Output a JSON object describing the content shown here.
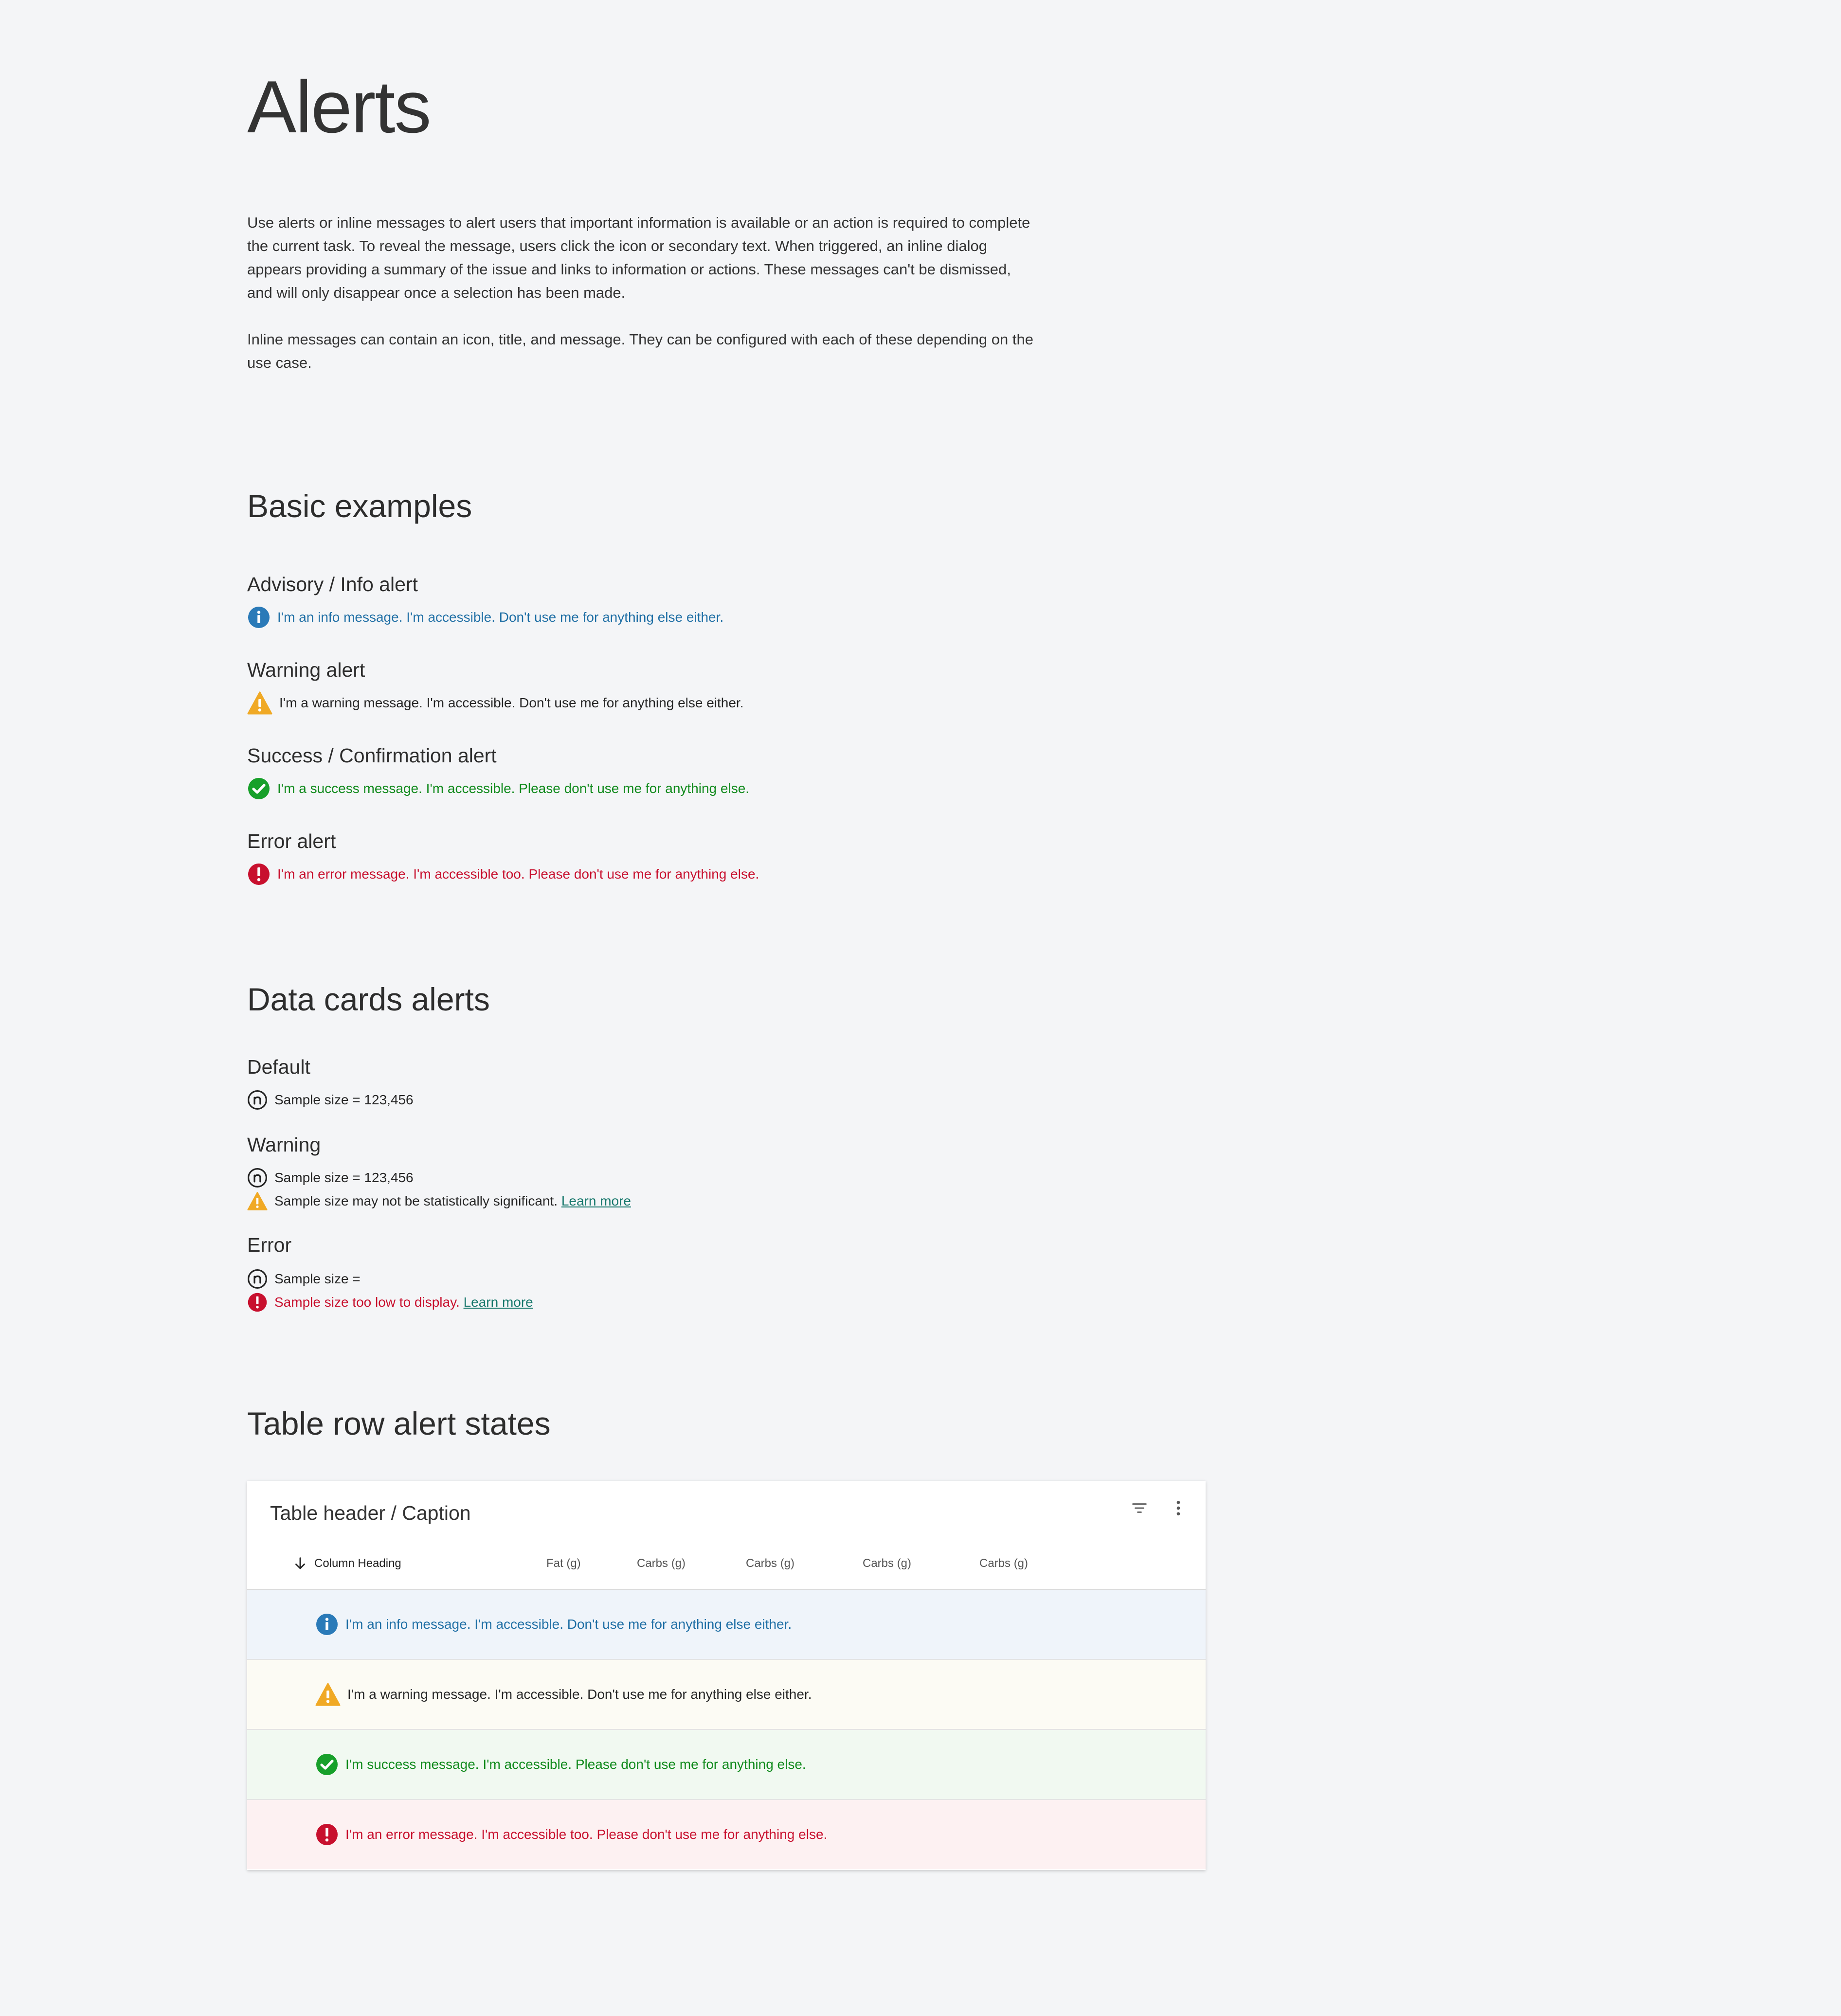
{
  "page": {
    "title": "Alerts",
    "intro_paragraphs": [
      "Use alerts or inline messages to alert users that important information is available or an action is required to complete the current task. To reveal the message, users click the icon or secondary text. When triggered, an inline dialog appears providing a summary of the issue and links to information or actions. These messages can't be dismissed, and will only disappear once a selection has been made.",
      "Inline messages can contain an icon, title, and message. They can be configured with each of these depending on the use case."
    ]
  },
  "basic": {
    "heading": "Basic examples",
    "items": [
      {
        "label": "Advisory / Info alert",
        "icon": "info-icon",
        "message": "I'm an info message. I'm accessible. Don't use me for anything else either."
      },
      {
        "label": "Warning alert",
        "icon": "warning-icon",
        "message": "I'm a warning message. I'm accessible. Don't use me for anything else either."
      },
      {
        "label": "Success / Confirmation alert",
        "icon": "success-icon",
        "message": "I'm a success message. I'm accessible. Please don't use me for anything else."
      },
      {
        "label": "Error alert",
        "icon": "error-icon",
        "message": "I'm an error message. I'm accessible too. Please don't use me for anything else."
      }
    ]
  },
  "datacards": {
    "heading": "Data cards alerts",
    "default": {
      "label": "Default",
      "sample": "Sample size = 123,456"
    },
    "warning": {
      "label": "Warning",
      "sample": "Sample size = 123,456",
      "message": "Sample size may not be statistically significant.",
      "link": "Learn more"
    },
    "error": {
      "label": "Error",
      "sample": "Sample size =",
      "message": "Sample size too low to display.",
      "link": "Learn more"
    }
  },
  "table": {
    "heading": "Table row alert states",
    "caption": "Table header / Caption",
    "icons": {
      "filter": "filter-icon",
      "more": "more-vert-icon",
      "sort": "arrow-down-icon"
    },
    "columns": [
      "Column Heading",
      "Fat (g)",
      "Carbs (g)",
      "Carbs (g)",
      "Carbs (g)",
      "Carbs (g)"
    ],
    "rows": [
      {
        "type": "info",
        "message": "I'm an info message. I'm accessible. Don't use me for anything else either."
      },
      {
        "type": "warning",
        "message": "I'm a warning message. I'm accessible. Don't use me for anything else either."
      },
      {
        "type": "success",
        "message": "I'm success message. I'm accessible. Please don't use me for anything else."
      },
      {
        "type": "error",
        "message": "I'm an error message. I'm accessible too. Please don't use me for anything else."
      }
    ]
  },
  "colors": {
    "background": "#f4f5f7",
    "info": "#1f6fa5",
    "info_icon": "#2a7ab8",
    "warning_icon": "#f0a925",
    "success": "#108a1c",
    "error": "#c8102e",
    "link": "#17786c",
    "row_info_bg": "#eff4fa",
    "row_warning_bg": "#fcfbf4",
    "row_success_bg": "#f1f9f1",
    "row_error_bg": "#fdf1f2"
  }
}
